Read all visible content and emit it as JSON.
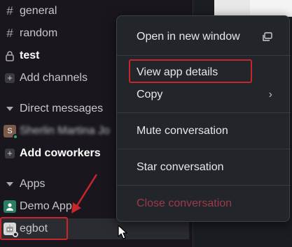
{
  "sidebar": {
    "channels": [
      {
        "label": "general",
        "icon": "hash-icon",
        "bold": false
      },
      {
        "label": "random",
        "icon": "hash-icon",
        "bold": false
      },
      {
        "label": "test",
        "icon": "lock-icon",
        "bold": true
      }
    ],
    "add_channels_label": "Add channels",
    "direct_messages_label": "Direct messages",
    "dm_user": {
      "initial": "S",
      "name": "Sherlin Martina Jo",
      "presence_color": "#2bac76"
    },
    "add_coworkers_label": "Add coworkers",
    "apps_label": "Apps",
    "apps": [
      {
        "label": "Demo App",
        "avatar_color": "#2a7f62"
      },
      {
        "label": "egbot",
        "avatar_color": "#d9d9da"
      }
    ]
  },
  "context_menu": {
    "open_new_window": "Open in new window",
    "view_app_details": "View app details",
    "copy": "Copy",
    "copy_submenu_glyph": "›",
    "mute": "Mute conversation",
    "star": "Star conversation",
    "close": "Close conversation"
  },
  "colors": {
    "sidebar_bg": "#19171d",
    "menu_bg": "#222529",
    "highlight_red": "#c8252c",
    "danger_text": "#9b3b4b"
  }
}
